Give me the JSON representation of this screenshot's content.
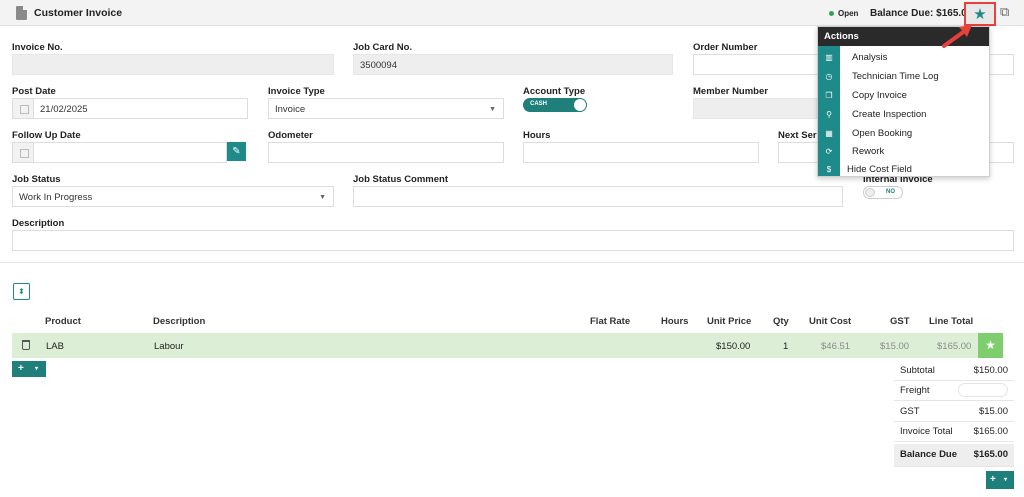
{
  "header": {
    "title": "Customer Invoice",
    "status": "Open",
    "balance_due": "Balance Due: $165.00",
    "status_color": "#2ea84a",
    "accent_color": "#1f8a8a"
  },
  "form": {
    "invoice_no": {
      "label": "Invoice No.",
      "value": ""
    },
    "job_card_no": {
      "label": "Job Card No.",
      "value": "3500094"
    },
    "order_number": {
      "label": "Order Number",
      "value": ""
    },
    "post_date": {
      "label": "Post Date",
      "value": "21/02/2025"
    },
    "invoice_type": {
      "label": "Invoice Type",
      "value": "Invoice"
    },
    "account_type": {
      "label": "Account Type",
      "toggle": "CASH"
    },
    "member_number": {
      "label": "Member Number",
      "value": ""
    },
    "follow_up_date": {
      "label": "Follow Up Date",
      "value": ""
    },
    "odometer": {
      "label": "Odometer",
      "value": ""
    },
    "hours": {
      "label": "Hours",
      "value": ""
    },
    "next_service": {
      "label": "Next Ser",
      "value": ""
    },
    "job_status": {
      "label": "Job Status",
      "value": "Work In Progress"
    },
    "job_status_comment": {
      "label": "Job Status Comment",
      "value": ""
    },
    "internal_invoice": {
      "label": "Internal Invoice",
      "toggle": "NO"
    },
    "description": {
      "label": "Description",
      "value": ""
    }
  },
  "table": {
    "columns": [
      "Product",
      "Description",
      "Flat Rate",
      "Hours",
      "Unit Price",
      "Qty",
      "Unit Cost",
      "GST",
      "Line Total"
    ],
    "rows": [
      {
        "product": "LAB",
        "description": "Labour",
        "flat_rate": "",
        "hours": "",
        "unit_price": "$150.00",
        "qty": "1",
        "unit_cost": "$46.51",
        "gst": "$15.00",
        "line_total": "$165.00"
      }
    ]
  },
  "totals": {
    "subtotal": {
      "label": "Subtotal",
      "value": "$150.00"
    },
    "freight": {
      "label": "Freight",
      "value": ""
    },
    "gst": {
      "label": "GST",
      "value": "$15.00"
    },
    "invoice_total": {
      "label": "Invoice Total",
      "value": "$165.00"
    },
    "balance_due": {
      "label": "Balance Due",
      "value": "$165.00"
    }
  },
  "actions_menu": {
    "title": "Actions",
    "items": [
      {
        "label": "Analysis",
        "icon": "bar-chart-icon"
      },
      {
        "label": "Technician Time Log",
        "icon": "clock-icon"
      },
      {
        "label": "Copy Invoice",
        "icon": "copy-icon"
      },
      {
        "label": "Create Inspection",
        "icon": "search-icon"
      },
      {
        "label": "Open Booking",
        "icon": "calendar-icon"
      },
      {
        "label": "Rework",
        "icon": "refresh-icon"
      },
      {
        "label": "Hide Cost Field",
        "icon": "dollar-icon"
      }
    ]
  },
  "buttons": {
    "add": "+",
    "add_caret": "▾"
  },
  "annotation": {
    "arrow_color": "#e8413b"
  }
}
